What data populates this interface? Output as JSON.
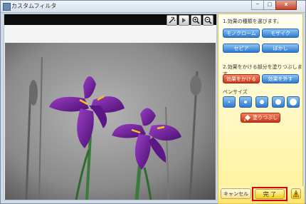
{
  "window": {
    "title": "カスタムフィルタ",
    "controls": {
      "minimize": "─",
      "maximize": "□",
      "close": "x"
    }
  },
  "toolbar": {
    "icons": [
      "wand-icon",
      "rotate-icon",
      "zoom-in-icon",
      "zoom-out-icon"
    ]
  },
  "panel": {
    "step1_label": "1.効果の種類を選びます。",
    "effects": [
      "モノクローム",
      "モザイク",
      "セピア",
      "ぼかし"
    ],
    "step2_label": "2.効果をかける部分を塗りつぶします。",
    "apply_effect": "効果をかける",
    "remove_effect": "効果を外す",
    "pen_size_label": "ペンサイズ",
    "pen_sizes_count": 5,
    "paint_all_label": "塗りつぶし"
  },
  "footer": {
    "cancel_label": "キャンセル",
    "done_label": "完 了"
  },
  "colors": {
    "accent_blue": "#2d79cf",
    "accent_red": "#c8361b",
    "panel_yellow": "#fff3a0",
    "highlight": "#e10000",
    "flower_purple": "#6a1b9a"
  }
}
